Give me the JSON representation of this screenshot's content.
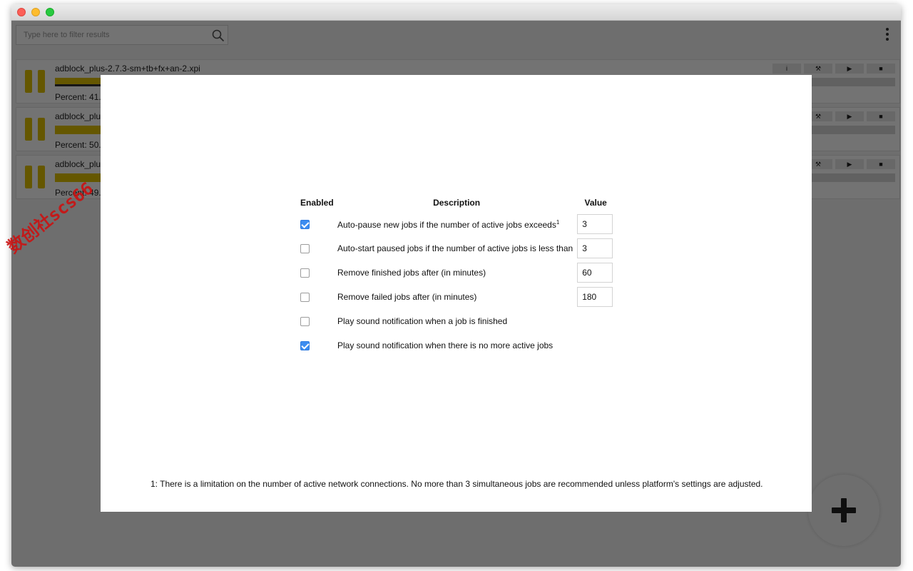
{
  "filter": {
    "placeholder": "Type here to filter results"
  },
  "jobs": [
    {
      "name": "adblock_plus-2.7.3-sm+tb+fx+an-2.xpi",
      "status": "Percent: 41.",
      "progress": 0.41,
      "strip": 0.35
    },
    {
      "name": "adblock_plu",
      "status": "Percent: 50.",
      "progress": 0.5,
      "strip": 0
    },
    {
      "name": "adblock_plu",
      "status": "Percent: 49.",
      "progress": 0.49,
      "strip": 0
    }
  ],
  "job_buttons": {
    "info": "i",
    "tools": "⚒",
    "play": "▶",
    "stop": "■"
  },
  "watermark": "数创社scs66",
  "settings": {
    "headers": {
      "enabled": "Enabled",
      "description": "Description",
      "value": "Value"
    },
    "rows": [
      {
        "enabled": true,
        "description": "Auto-pause new jobs if the number of active jobs exceeds",
        "sup": "1",
        "value": "3"
      },
      {
        "enabled": false,
        "description": "Auto-start paused jobs if the number of active jobs is less than",
        "sup": "",
        "value": "3"
      },
      {
        "enabled": false,
        "description": "Remove finished jobs after (in minutes)",
        "sup": "",
        "value": "60"
      },
      {
        "enabled": false,
        "description": "Remove failed jobs after (in minutes)",
        "sup": "",
        "value": "180"
      },
      {
        "enabled": false,
        "description": "Play sound notification when a job is finished",
        "sup": "",
        "value": null
      },
      {
        "enabled": true,
        "description": "Play sound notification when there is no more active jobs",
        "sup": "",
        "value": null
      }
    ],
    "footnote": "1: There is a limitation on the number of active network connections. No more than 3 simultaneous jobs are recommended unless platform's settings are adjusted."
  },
  "colors": {
    "accent": "#3d8df0",
    "progress": "#e1c100",
    "overlay": "rgba(0,0,0,0.55)"
  },
  "icons": {
    "search": "search-icon",
    "menu": "more-vertical-icon",
    "pause": "pause-icon",
    "add": "plus-icon"
  }
}
